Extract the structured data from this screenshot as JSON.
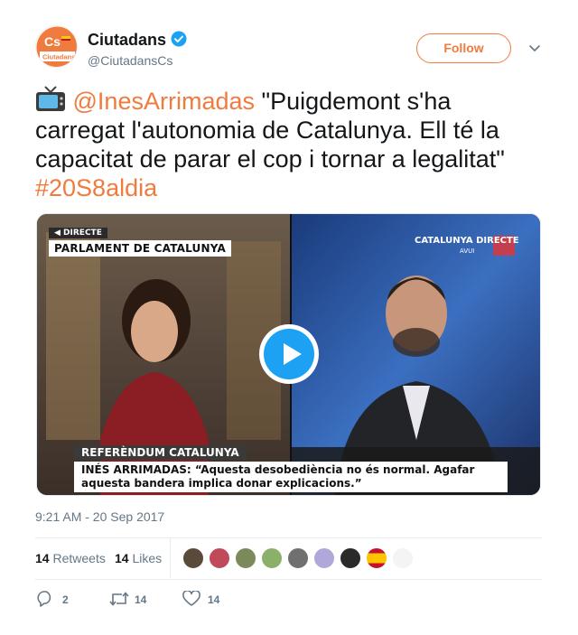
{
  "author": {
    "display_name": "Ciutadans",
    "screen_name": "@CiutadansCs",
    "avatar_logo_text": "Cs",
    "avatar_sub_text": "Ciutadans",
    "verified": true,
    "brand_color": "#f07b3e"
  },
  "follow_label": "Follow",
  "tweet": {
    "icon": "tv-icon",
    "mention": "@InesArrimadas",
    "quote": " \"Puigdemont s'ha carregat l'autonomia de Catalunya. Ell té la capacitat de parar el cop i tornar a legalitat\"",
    "hashtag": "#20S8aldia"
  },
  "video": {
    "live_tag": "◀ DIRECTE",
    "top_chyron": "PARLAMENT DE CATALUNYA",
    "channel_label": "CATALUNYA DIRECTE",
    "channel_sub": "AVUI",
    "lower_title": "REFERÈNDUM CATALUNYA",
    "lower_quote": "INÉS ARRIMADAS: “Aquesta desobediència no és normal. Agafar aquesta bandera implica donar explicacions.”",
    "play_icon": "play-icon"
  },
  "timestamp": "9:21 AM - 20 Sep 2017",
  "stats": {
    "retweets_count": "14",
    "retweets_label": "Retweets",
    "likes_count": "14",
    "likes_label": "Likes"
  },
  "likers": [
    {
      "name": "liker-avatar-1",
      "color": "#5a4a3a"
    },
    {
      "name": "liker-avatar-2",
      "color": "#c04a5a"
    },
    {
      "name": "liker-avatar-3",
      "color": "#7a8a5a"
    },
    {
      "name": "liker-avatar-4",
      "color": "#8ab06a"
    },
    {
      "name": "liker-avatar-5",
      "color": "#707070"
    },
    {
      "name": "liker-avatar-6",
      "color": "#b0a8d8"
    },
    {
      "name": "liker-avatar-7",
      "color": "#2a2a2a"
    },
    {
      "name": "liker-avatar-8",
      "color": "#c8102e"
    },
    {
      "name": "liker-avatar-9",
      "color": "#f4f4f4"
    }
  ],
  "actions": {
    "reply_count": "2",
    "retweet_count": "14",
    "like_count": "14"
  },
  "colors": {
    "link": "#f07b3e",
    "muted": "#657786",
    "play": "#1da1f2"
  }
}
